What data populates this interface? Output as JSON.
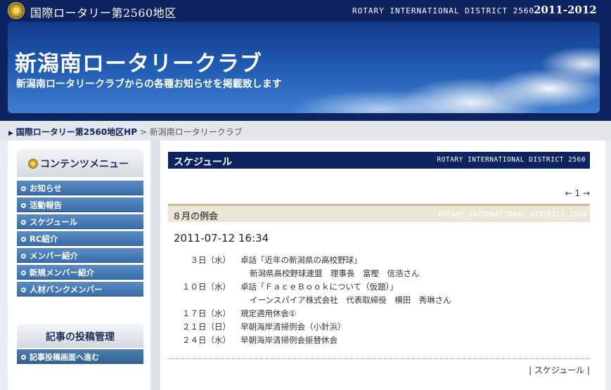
{
  "topbar": {
    "district_jp": "国際ロータリー第2560地区",
    "district_en": "ROTARY INTERNATIONAL DISTRICT 2560",
    "years": "2011-2012"
  },
  "banner": {
    "club_name": "新潟南ロータリークラブ",
    "subtitle": "新潟南ロータリークラブからの各種お知らせを掲載致します"
  },
  "breadcrumb": {
    "home_link": "国際ロータリー第2560地区HP",
    "separator": ">",
    "current": "新潟南ロータリークラブ"
  },
  "sidebar": {
    "menu_title": "コンテンツメニュー",
    "items": [
      {
        "label": "お知らせ"
      },
      {
        "label": "活動報告"
      },
      {
        "label": "スケジュール"
      },
      {
        "label": "RC紹介"
      },
      {
        "label": "メンバー紹介"
      },
      {
        "label": "新規メンバー紹介"
      },
      {
        "label": "人材バンクメンバー"
      }
    ],
    "post_title": "記事の投稿管理",
    "post_link": "記事投稿画面へ進む"
  },
  "content": {
    "section_title": "スケジュール",
    "section_en": "ROTARY INTERNATIONAL DISTRICT 2560",
    "pager": "← 1 →",
    "article_title": "８月の例会",
    "article_en": "ROTARY INTERNATIONAL DISTRICT 2560",
    "date": "2011-07-12 16:34",
    "events": [
      {
        "day": "３日（水）",
        "text": "卓話「近年の新潟県の高校野球」",
        "detail": "新潟県高校野球連盟　理事長　富樫　信浩さん"
      },
      {
        "day": "１０日（水）",
        "text": "卓話「ＦａｃｅＢｏｏｋについて（仮題）」",
        "detail": "イーンスパイア株式会社　代表取締役　横田　秀琳さん"
      },
      {
        "day": "１７日（水）",
        "text": "規定適用休会①",
        "detail": ""
      },
      {
        "day": "２１日（日）",
        "text": "早朝海岸清掃例会（小針浜）",
        "detail": ""
      },
      {
        "day": "２４日（水）",
        "text": "早朝海岸清掃例会振替休会",
        "detail": ""
      }
    ],
    "footer_link": "| スケジュール |"
  }
}
